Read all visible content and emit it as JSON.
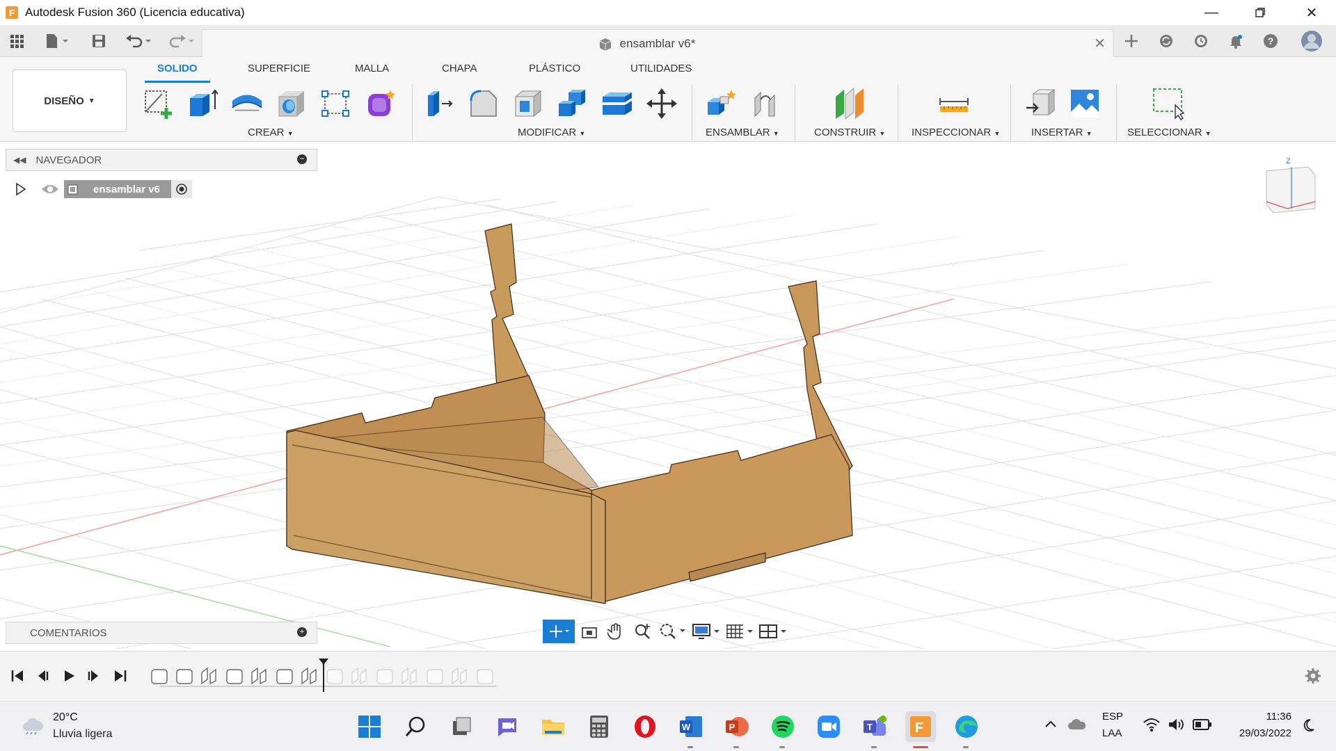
{
  "window": {
    "title": "Autodesk Fusion 360 (Licencia educativa)",
    "app_icon_letter": "F",
    "controls": [
      "minimize-icon",
      "restore-icon",
      "close-icon"
    ]
  },
  "document_tab": {
    "name": "ensamblar v6*"
  },
  "ribbon": {
    "workspace": "DISEÑO",
    "tabs": [
      "SOLIDO",
      "SUPERFICIE",
      "MALLA",
      "CHAPA",
      "PLÁSTICO",
      "UTILIDADES"
    ],
    "active_tab": "SOLIDO",
    "groups": [
      "CREAR",
      "MODIFICAR",
      "ENSAMBLAR",
      "CONSTRUIR",
      "INSPECCIONAR",
      "INSERTAR",
      "SELECCIONAR"
    ],
    "accent": "#1a7fd4"
  },
  "navigator": {
    "title": "NAVEGADOR",
    "root_node": "ensamblar v6"
  },
  "comments": {
    "title": "COMENTARIOS"
  },
  "viewcube": {
    "axis_label": "Z"
  },
  "taskbar": {
    "weather_temp": "20°C",
    "weather_desc": "Lluvia ligera",
    "lang_top": "ESP",
    "lang_bottom": "LAA",
    "time": "11:36",
    "date": "29/03/2022"
  },
  "colors": {
    "wood": "#c89a5c",
    "wood_dark": "#a8783e",
    "grid": "#d9d9d9",
    "x_axis": "#f3a0a0",
    "y_axis": "#a8dca0"
  }
}
